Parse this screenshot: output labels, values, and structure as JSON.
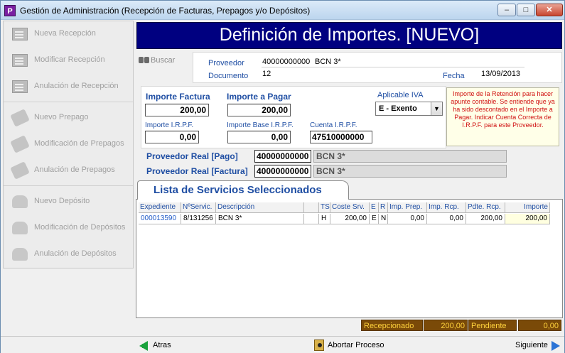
{
  "window": {
    "title": "Gestión de Administración (Recepción de Facturas, Prepagos y/o Depósitos)",
    "app_icon": "P"
  },
  "sidebar": {
    "items": [
      {
        "label": "Nueva Recepción",
        "icon": "document-list-icon"
      },
      {
        "label": "Modificar Recepción",
        "icon": "document-edit-icon"
      },
      {
        "label": "Anulación de Recepción",
        "icon": "document-cancel-icon"
      },
      {
        "label": "Nuevo Prepago",
        "icon": "tag-icon"
      },
      {
        "label": "Modificación de Prepagos",
        "icon": "tag-edit-icon"
      },
      {
        "label": "Anulación de Prepagos",
        "icon": "tag-cancel-icon"
      },
      {
        "label": "Nuevo Depósito",
        "icon": "money-icon"
      },
      {
        "label": "Modificación de Depósitos",
        "icon": "money-edit-icon"
      },
      {
        "label": "Anulación de Depósitos",
        "icon": "money-cancel-icon"
      }
    ]
  },
  "header": {
    "title": "Definición de Importes. [NUEVO]"
  },
  "search": {
    "label": "Buscar"
  },
  "proveedor": {
    "label": "Proveedor",
    "code": "40000000000",
    "name": "BCN 3*",
    "documento_label": "Documento",
    "documento": "12",
    "fecha_label": "Fecha",
    "fecha": "13/09/2013"
  },
  "importes": {
    "importe_factura_label": "Importe Factura",
    "importe_factura": "200,00",
    "importe_pagar_label": "Importe a Pagar",
    "importe_pagar": "200,00",
    "aplicable_iva_label": "Aplicable IVA",
    "aplicable_iva": "E - Exento",
    "importe_irpf_label": "Importe I.R.P.F.",
    "importe_irpf": "0,00",
    "importe_base_irpf_label": "Importe Base I.R.P.F.",
    "importe_base_irpf": "0,00",
    "cuenta_irpf_label": "Cuenta I.R.P.F.",
    "cuenta_irpf": "47510000000"
  },
  "note": "Importe de la Retención para hacer apunte contable. Se entiende que ya ha sido descontado en el Importe a Pagar. Indicar Cuenta Correcta de I.R.P.F. para este Proveedor.",
  "proveedor_real": {
    "pago_label": "Proveedor Real [Pago]",
    "pago_code": "40000000000",
    "pago_name": "BCN 3*",
    "factura_label": "Proveedor Real [Factura]",
    "factura_code": "40000000000",
    "factura_name": "BCN 3*"
  },
  "tab": {
    "label": "Lista de Servicios Seleccionados"
  },
  "table": {
    "columns": [
      "Expediente",
      "NºServic.",
      "Descripción",
      "",
      "TS",
      "Coste Srv.",
      "E",
      "R",
      "Imp. Prep.",
      "Imp. Rcp.",
      "Pdte. Rcp.",
      "Importe"
    ],
    "rows": [
      [
        "000013590",
        "8/131256",
        "BCN 3*",
        "",
        "H",
        "200,00",
        "E",
        "N",
        "0,00",
        "0,00",
        "200,00",
        "200,00"
      ]
    ]
  },
  "totals": {
    "recepcionado_label": "Recepcionado",
    "recepcionado": "200,00",
    "pendiente_label": "Pendiente",
    "pendiente": "0,00"
  },
  "footer": {
    "back_label": "Atras",
    "abort_label": "Abortar Proceso",
    "next_label": "Siguiente"
  },
  "colors": {
    "header_bg": "#000080",
    "label_blue": "#1f4ea3",
    "note_red": "#d01010",
    "totals_bg": "#7a4a08",
    "totals_fg": "#ffd23c"
  }
}
